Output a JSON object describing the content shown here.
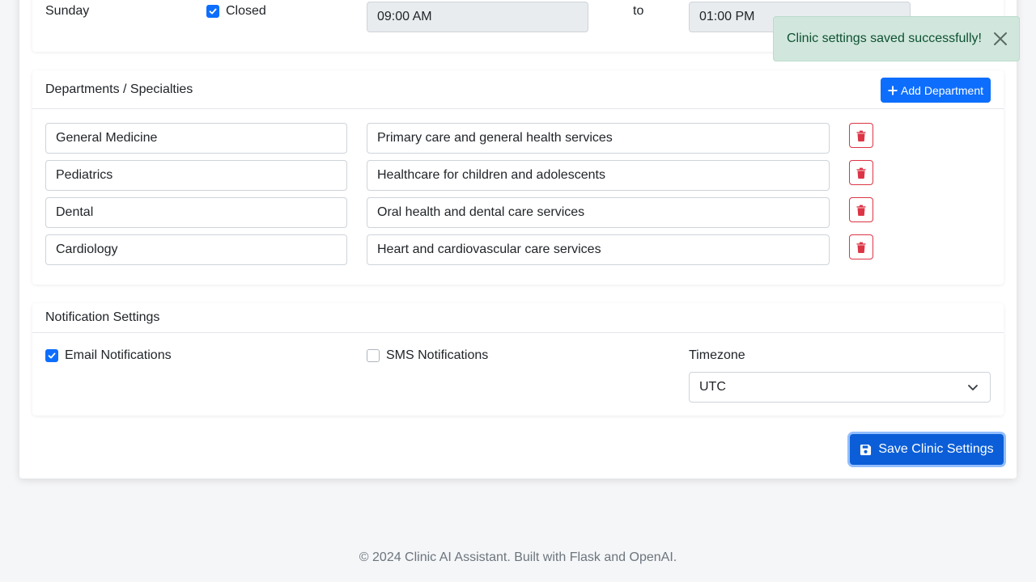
{
  "hours": {
    "day": "Sunday",
    "closed_label": "Closed",
    "closed_checked": true,
    "open_time": "09:00 AM",
    "to_label": "to",
    "close_time": "01:00 PM"
  },
  "toast": {
    "message": "Clinic settings saved successfully!",
    "close_icon": "close-icon"
  },
  "departments": {
    "title": "Departments / Specialties",
    "add_label": "Add Department",
    "items": [
      {
        "name": "General Medicine",
        "description": "Primary care and general health services"
      },
      {
        "name": "Pediatrics",
        "description": "Healthcare for children and adolescents"
      },
      {
        "name": "Dental",
        "description": "Oral health and dental care services"
      },
      {
        "name": "Cardiology",
        "description": "Heart and cardiovascular care services"
      }
    ],
    "delete_icon": "trash-icon"
  },
  "notifications": {
    "title": "Notification Settings",
    "email_label": "Email Notifications",
    "email_checked": true,
    "sms_label": "SMS Notifications",
    "sms_checked": false,
    "timezone_label": "Timezone",
    "timezone_value": "UTC"
  },
  "actions": {
    "save_label": "Save Clinic Settings",
    "save_icon": "floppy-disk-icon"
  },
  "footer": {
    "text": "© 2024 Clinic AI Assistant. Built with Flask and OpenAI."
  },
  "colors": {
    "primary": "#0d6efd",
    "danger": "#dc3545",
    "success_bg": "#d1e7dd",
    "success_text": "#0f5132"
  }
}
